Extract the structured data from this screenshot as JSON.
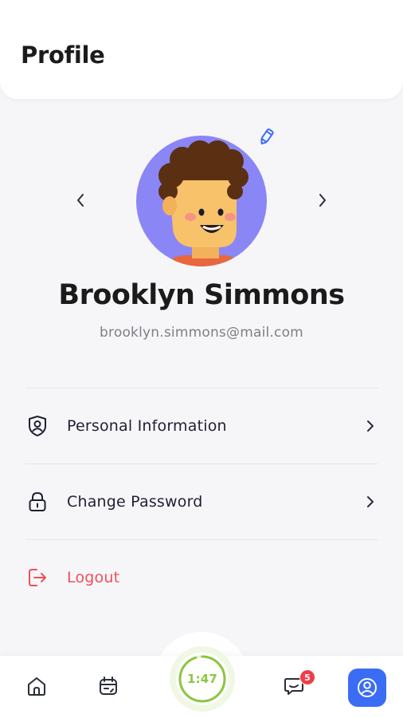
{
  "header": {
    "title": "Profile"
  },
  "profile": {
    "name": "Brooklyn Simmons",
    "email": "brooklyn.simmons@mail.com"
  },
  "menu": {
    "items": [
      {
        "label": "Personal Information",
        "icon": "user-shield-icon"
      },
      {
        "label": "Change Password",
        "icon": "lock-icon"
      },
      {
        "label": "Logout",
        "icon": "logout-icon"
      }
    ]
  },
  "tabbar": {
    "timer": "1:47",
    "timer_progress_percent": 95,
    "chat_badge": "5",
    "icons": [
      "home-icon",
      "calendar-icon",
      "timer-icon",
      "chat-icon",
      "profile-icon"
    ]
  },
  "colors": {
    "accent_blue": "#3b6cf6",
    "logout_red": "#f04f59",
    "timer_green": "#8cc63f",
    "avatar_bg": "#8a86f6"
  }
}
